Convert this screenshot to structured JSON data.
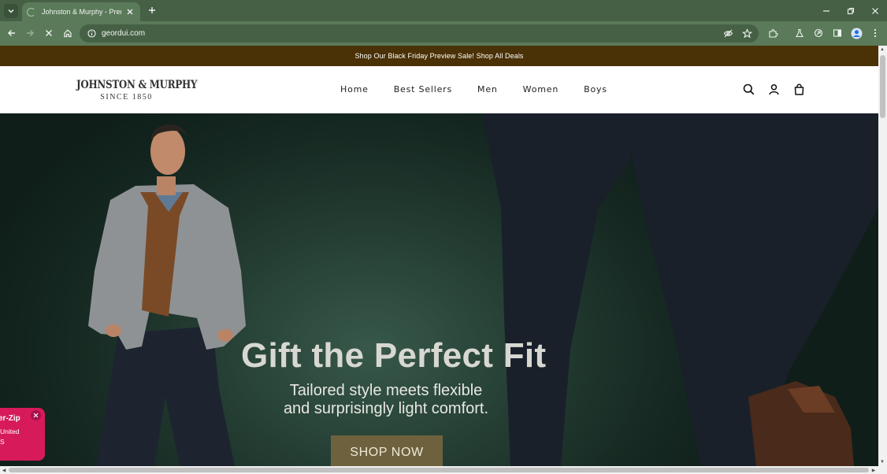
{
  "browser": {
    "tab": {
      "title": "Johnston & Murphy - Premium"
    },
    "address": {
      "url": "geordui.com"
    }
  },
  "promo": {
    "text": "Shop Our Black Friday Preview Sale! Shop All Deals"
  },
  "header": {
    "logo": {
      "name": "JOHNSTON & MURPHY",
      "since": "SINCE 1850"
    },
    "nav": [
      {
        "label": "Home"
      },
      {
        "label": "Best Sellers"
      },
      {
        "label": "Men"
      },
      {
        "label": "Women"
      },
      {
        "label": "Boys"
      }
    ],
    "icons": [
      "search-icon",
      "account-icon",
      "bag-icon"
    ]
  },
  "hero": {
    "title": "Gift the Perfect Fit",
    "subtitle_line1": "Tailored style meets flexible",
    "subtitle_line2": "and surprisingly light comfort.",
    "cta": "SHOP NOW"
  },
  "popup": {
    "title": "er-Zip",
    "line1": "United",
    "line2": "S"
  },
  "colors": {
    "chrome_dark": "#466046",
    "chrome": "#5a7a5a",
    "promo_bg": "#4a3106",
    "cta_bg": "#6e623e",
    "popup_bg": "#d61a5a"
  }
}
